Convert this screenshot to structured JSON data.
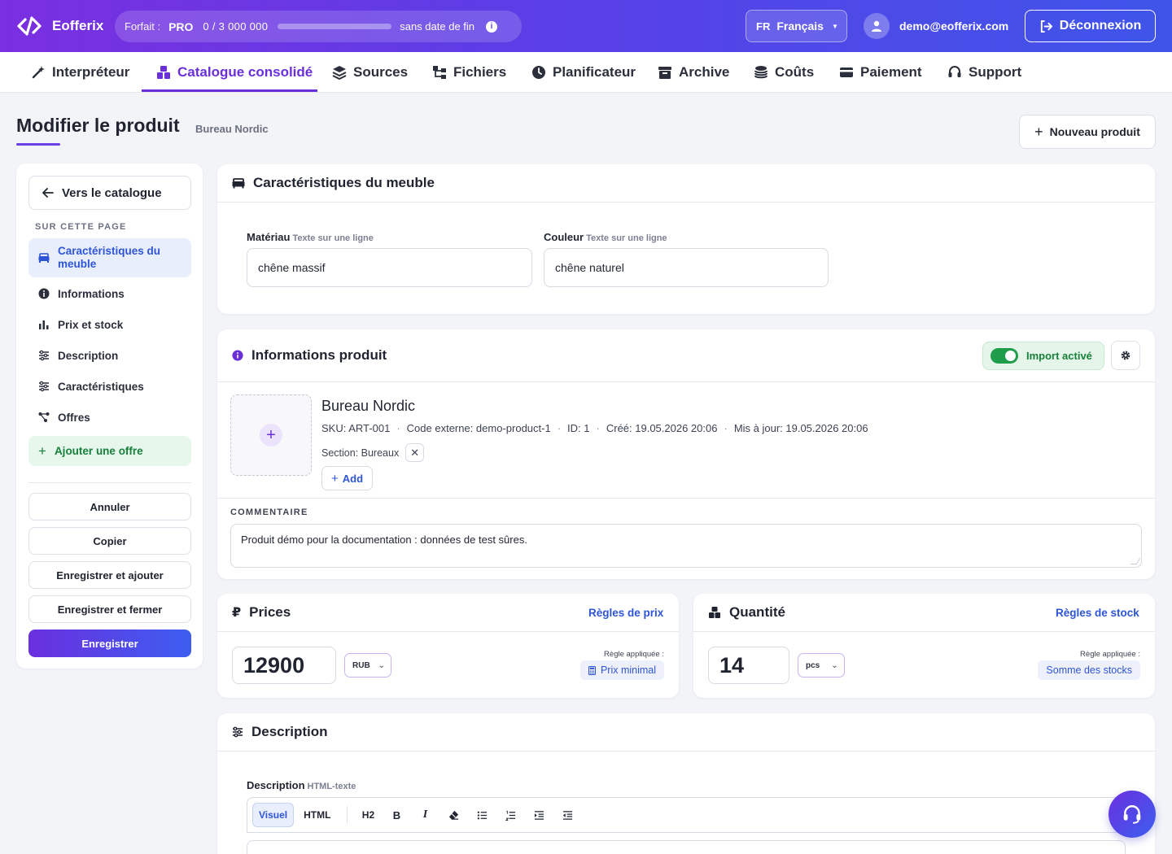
{
  "app": {
    "brand": "Eofferix"
  },
  "plan": {
    "label": "Forfait :",
    "tier": "PRO",
    "usage": "0  /  3 000 000",
    "usage_fraction": 0.0,
    "validity": "sans date de fin"
  },
  "language": {
    "code": "FR",
    "name": "Français"
  },
  "user": {
    "email": "demo@eofferix.com",
    "logout_label": "Déconnexion"
  },
  "nav": {
    "items": [
      {
        "label": "Interpréteur",
        "icon": "magic-wand-icon"
      },
      {
        "label": "Catalogue consolidé",
        "icon": "boxes-icon",
        "active": true
      },
      {
        "label": "Sources",
        "icon": "layers-icon"
      },
      {
        "label": "Fichiers",
        "icon": "sitemap-icon"
      },
      {
        "label": "Planificateur",
        "icon": "clock-icon"
      },
      {
        "label": "Archive",
        "icon": "archive-icon"
      },
      {
        "label": "Coûts",
        "icon": "coins-icon"
      },
      {
        "label": "Paiement",
        "icon": "credit-card-icon"
      },
      {
        "label": "Support",
        "icon": "headset-icon"
      }
    ]
  },
  "header": {
    "title": "Modifier le produit",
    "breadcrumb": "Bureau Nordic",
    "new_product_label": "Nouveau produit"
  },
  "sidebar": {
    "back_label": "Vers le catalogue",
    "toc_title": "SUR CETTE PAGE",
    "items": [
      {
        "label": "Caractéristiques du meuble",
        "icon": "sofa-icon",
        "active": true
      },
      {
        "label": "Informations",
        "icon": "info-circle-icon"
      },
      {
        "label": "Prix et stock",
        "icon": "bar-chart-icon"
      },
      {
        "label": "Description",
        "icon": "sliders-icon"
      },
      {
        "label": "Caractéristiques",
        "icon": "sliders-icon"
      },
      {
        "label": "Offres",
        "icon": "network-icon"
      }
    ],
    "add_offer_label": "Ajouter une offre",
    "buttons": {
      "cancel": "Annuler",
      "copy": "Copier",
      "save_add": "Enregistrer et ajouter",
      "save_close": "Enregistrer et fermer",
      "save": "Enregistrer"
    }
  },
  "furniture": {
    "title": "Caractéristiques du meuble",
    "material_label": "Matériau",
    "material_hint": "Texte sur une ligne",
    "material_value": "chêne massif",
    "color_label": "Couleur",
    "color_hint": "Texte sur une ligne",
    "color_value": "chêne naturel"
  },
  "info": {
    "title": "Informations produit",
    "import_label": "Import activé",
    "import_enabled": true,
    "product_name": "Bureau Nordic",
    "sku": "SKU: ART-001",
    "external_code": "Code externe: demo-product-1",
    "id": "ID: 1",
    "created": "Créé: 19.05.2026 20:06",
    "updated": "Mis à jour: 19.05.2026 20:06",
    "section": "Section: Bureaux",
    "add_label": "Add",
    "comment_label": "COMMENTAIRE",
    "comment_value": "Produit démo pour la documentation : données de test sûres."
  },
  "prices": {
    "title": "Prices",
    "rules_link": "Règles de prix",
    "value": "12900",
    "currency": "RUB",
    "applied_label": "Règle appliquée :",
    "applied_rule": "Prix minimal"
  },
  "quantity": {
    "title": "Quantité",
    "rules_link": "Règles de stock",
    "value": "14",
    "unit": "pcs",
    "applied_label": "Règle appliquée :",
    "applied_rule": "Somme des stocks"
  },
  "description": {
    "title": "Description",
    "field_label": "Description",
    "field_hint": "HTML-texte",
    "toolbar": {
      "visual": "Visuel",
      "html": "HTML",
      "h2": "H2",
      "bold": "B",
      "italic": "I"
    }
  },
  "colors": {
    "accent": "#6a2fd8",
    "link": "#2d55d6",
    "success": "#17803a",
    "gradient_start": "#7a2fe0",
    "gradient_end": "#3f55ea"
  }
}
